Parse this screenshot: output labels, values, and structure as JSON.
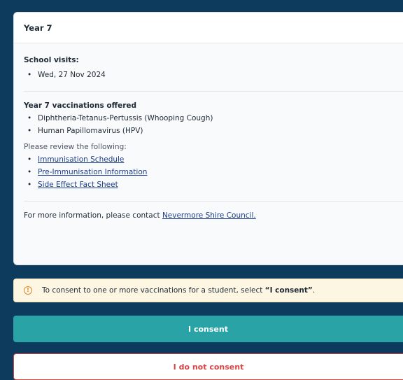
{
  "card": {
    "title": "Year 7",
    "school_visits": {
      "heading": "School visits:",
      "dates": [
        "Wed, 27 Nov 2024"
      ]
    },
    "vaccinations": {
      "heading": "Year 7 vaccinations offered",
      "items": [
        "Diphtheria-Tetanus-Pertussis (Whooping Cough)",
        "Human Papillomavirus (HPV)"
      ]
    },
    "review": {
      "intro": "Please review the following:",
      "links": [
        "Immunisation Schedule",
        "Pre-Immunisation Information",
        "Side Effect Fact Sheet"
      ]
    },
    "contact": {
      "prefix": "For more information, please contact ",
      "link": "Nevermore Shire Council."
    }
  },
  "alert": {
    "icon": "info-circle-icon",
    "text_prefix": "To consent to one or more vaccinations for a student, select ",
    "text_strong": "“I consent”",
    "text_suffix": "."
  },
  "buttons": {
    "consent": "I consent",
    "decline": "I do not consent"
  },
  "colors": {
    "background": "#0d3b5e",
    "consent": "#2aa3a6",
    "decline": "#d64545",
    "link": "#1a3f8c",
    "alert_bg": "#fdf6e3"
  }
}
